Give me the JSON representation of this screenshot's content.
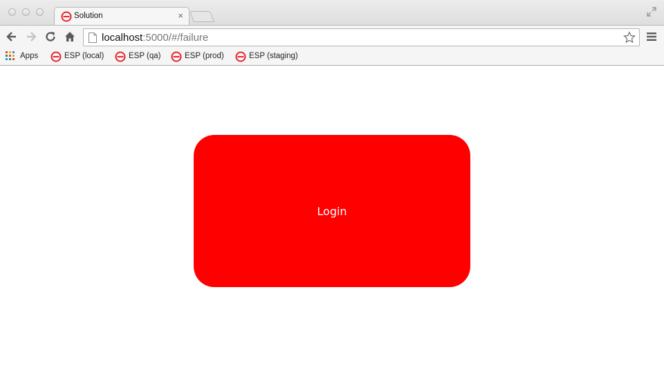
{
  "window": {
    "tab": {
      "title": "Solution",
      "close_glyph": "×",
      "favicon": "esp-logo-icon"
    }
  },
  "toolbar": {
    "url_host": "localhost",
    "url_rest": ":5000/#/failure",
    "icons": [
      "back-arrow-icon",
      "forward-arrow-icon",
      "reload-icon",
      "home-icon",
      "page-icon",
      "star-icon",
      "menu-icon"
    ]
  },
  "bookmarks": {
    "apps_label": "Apps",
    "items": [
      {
        "label": "ESP (local)"
      },
      {
        "label": "ESP (qa)"
      },
      {
        "label": "ESP (prod)"
      },
      {
        "label": "ESP (staging)"
      }
    ]
  },
  "main": {
    "login_label": "Login"
  },
  "colors": {
    "login_bg": "#ff0000",
    "esp_logo": "#e8242a"
  }
}
